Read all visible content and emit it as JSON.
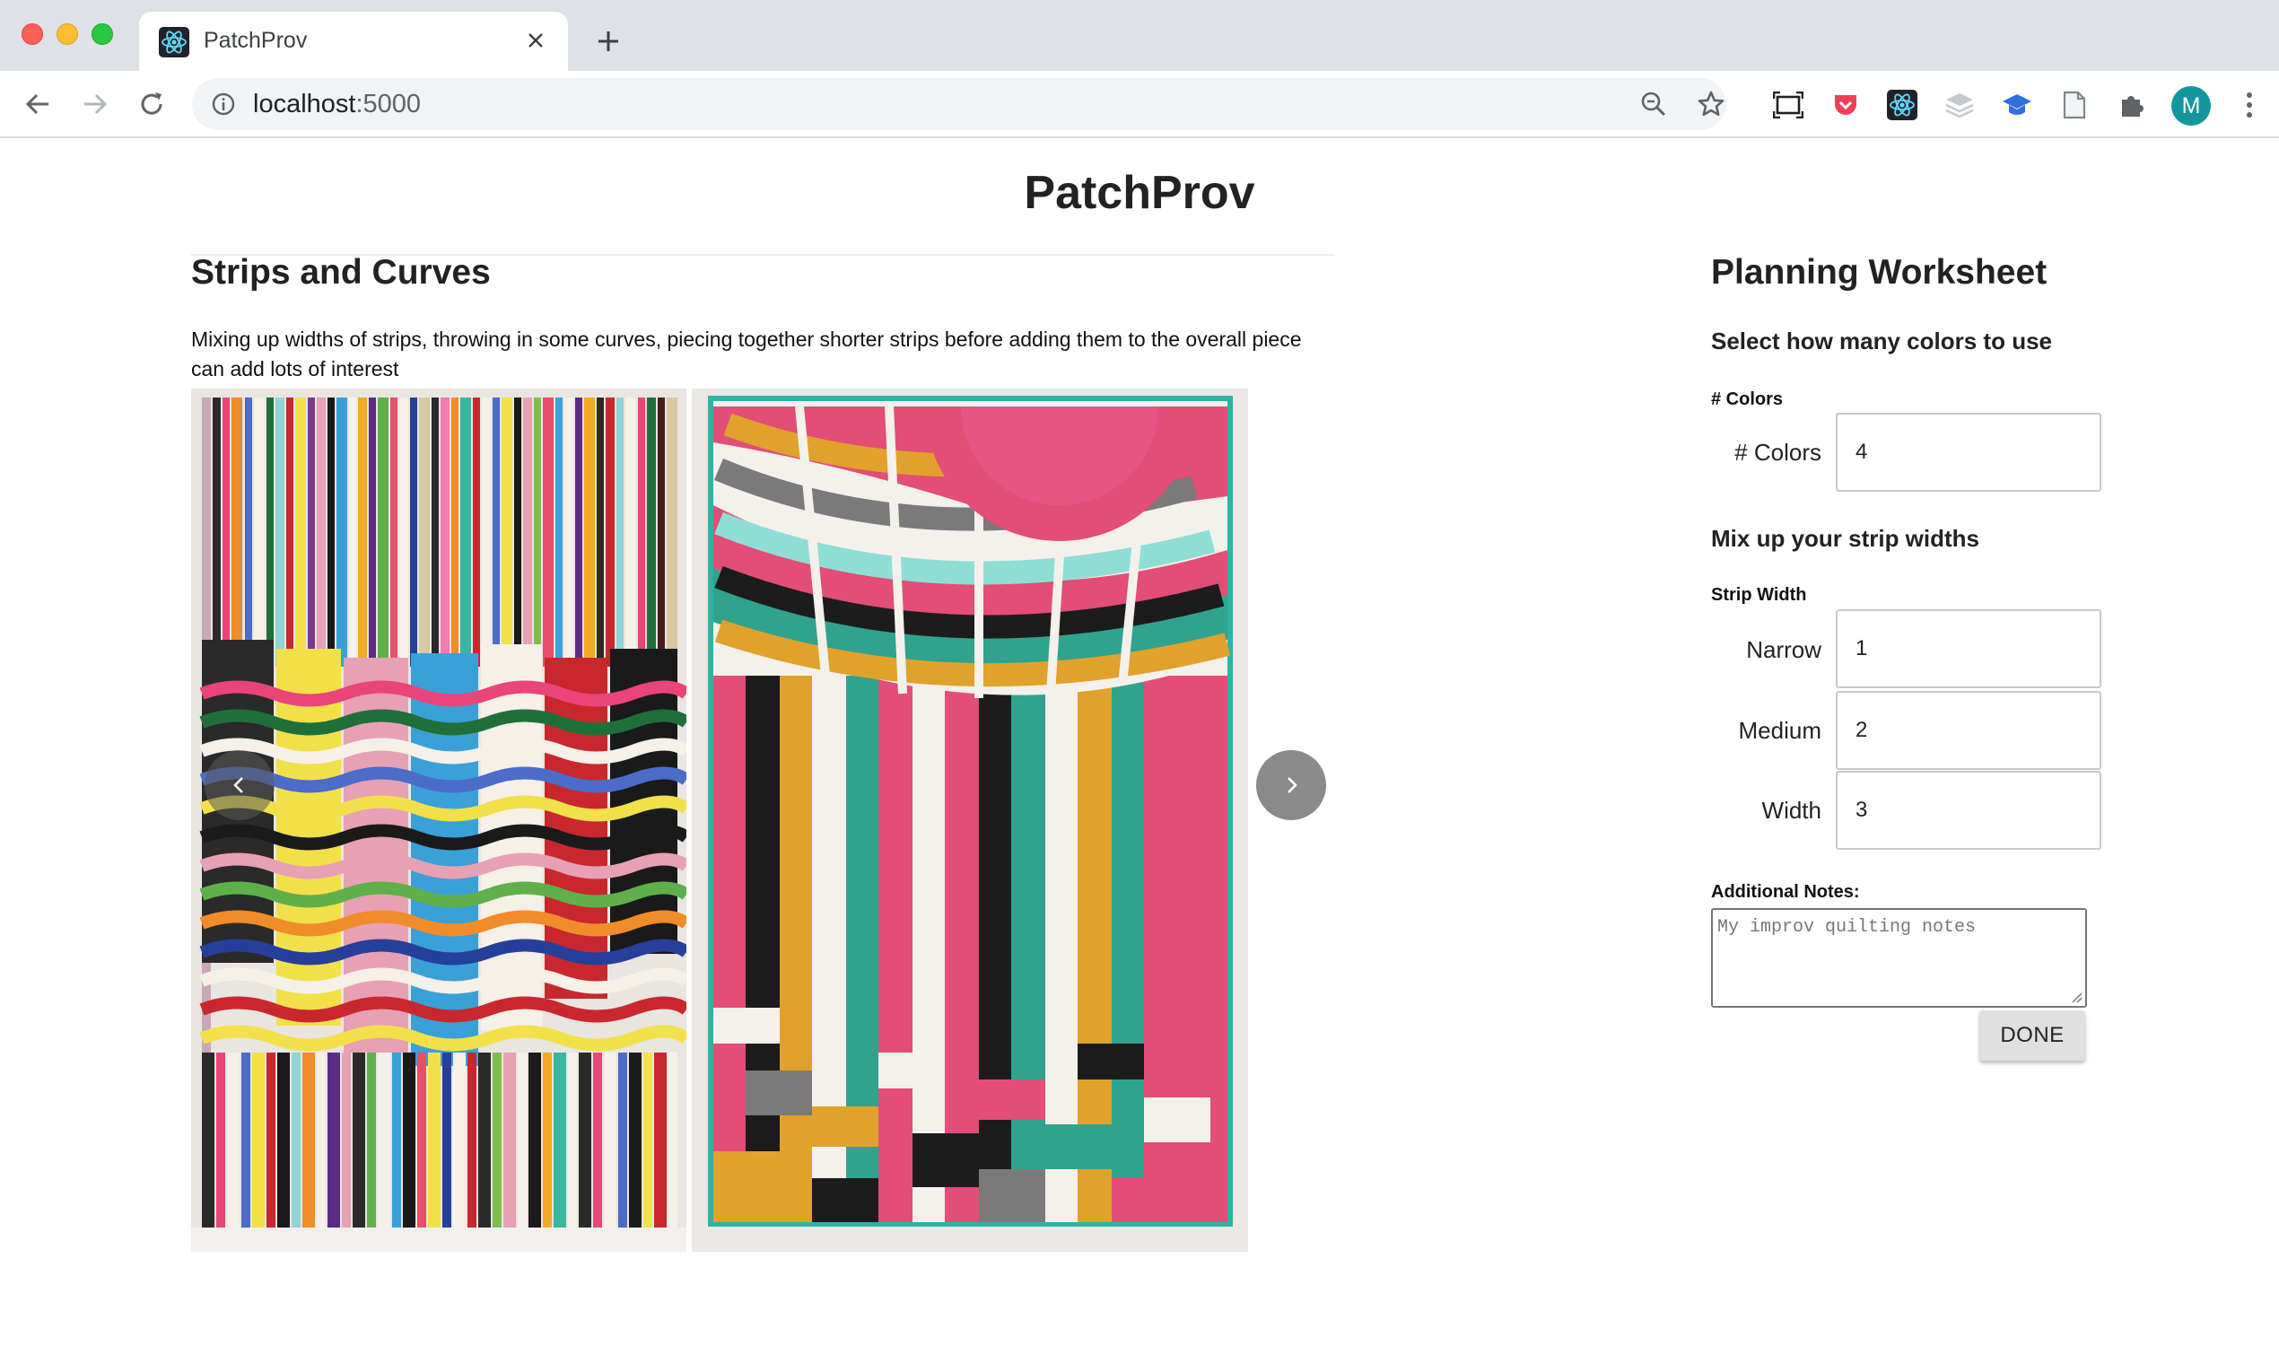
{
  "browser": {
    "tab_title": "PatchProv",
    "url_host": "localhost",
    "url_port": ":5000",
    "avatar_letter": "M"
  },
  "page": {
    "title": "PatchProv"
  },
  "idea": {
    "title": "Strips and Curves",
    "description": "Mixing up widths of strips, throwing in some curves, piecing together shorter strips before adding them to the overall piece can add lots of interest"
  },
  "worksheet": {
    "title": "Planning Worksheet",
    "colors_prompt": "Select how many colors to use",
    "colors_section_label": "# Colors",
    "colors_field_label": "# Colors",
    "colors_value": "4",
    "strips_prompt": "Mix up your strip widths",
    "strip_section_label": "Strip Width",
    "narrow_label": "Narrow",
    "narrow_value": "1",
    "medium_label": "Medium",
    "medium_value": "2",
    "width_label": "Width",
    "width_value": "3",
    "notes_label": "Additional Notes:",
    "notes_placeholder": "My improv quilting notes",
    "done_label": "DONE"
  },
  "colors": {
    "react": "#61dafb",
    "accent_teal": "#13979e"
  }
}
